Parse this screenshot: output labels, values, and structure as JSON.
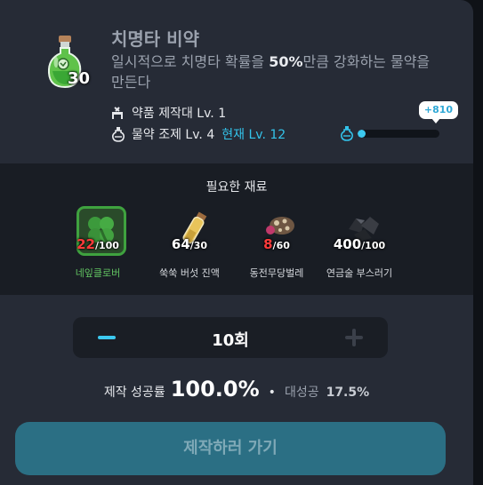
{
  "item": {
    "title": "치명타 비약",
    "quantity": "30",
    "desc_pre": "일시적으로 치명타 확률을 ",
    "desc_highlight": "50%",
    "desc_post": "만큼 강화하는 물약을 만든다",
    "icon": "green-potion-icon"
  },
  "requirements": {
    "station": "약품 제작대 Lv. 1",
    "skill": "물약 조제 Lv. 4",
    "current_level": "현재 Lv. 12",
    "exp_gain": "+810",
    "exp_progress": 0.1,
    "accent_color": "#33c3ea"
  },
  "materials": {
    "title": "필요한 재료",
    "items": [
      {
        "name": "네잎클로버",
        "have": "22",
        "need": "/100",
        "icon": "clover-icon",
        "insufficient": true,
        "selected": true
      },
      {
        "name": "쑥쑥 버섯 진액",
        "have": "64",
        "need": "/30",
        "icon": "extract-bottle-icon",
        "insufficient": false,
        "selected": false
      },
      {
        "name": "동전무당벌레",
        "have": "8",
        "need": "/60",
        "icon": "ladybug-icon",
        "insufficient": true,
        "selected": false
      },
      {
        "name": "연금술 부스러기",
        "have": "400",
        "need": "/100",
        "icon": "alchemy-scrap-icon",
        "insufficient": false,
        "selected": false
      }
    ]
  },
  "quantity": {
    "value": "10회"
  },
  "success": {
    "label": "제작 성공률",
    "value": "100.0%",
    "dot": "•",
    "great_label": "대성공",
    "great_value": "17.5%"
  },
  "cta": {
    "label": "제작하러 가기"
  }
}
